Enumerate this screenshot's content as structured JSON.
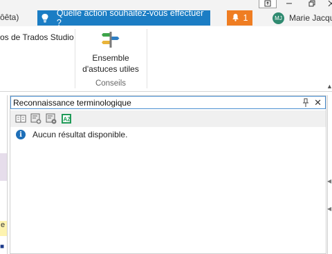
{
  "titlebar": {
    "beta_fragment": "ôêta)",
    "tell_me": "Quelle action souhaitez-vous effectuer ?",
    "notification_count": "1",
    "user_initials": "MJ",
    "user_name": "Marie Jacqu"
  },
  "ribbon": {
    "left_text": "os de Trados Studio",
    "tips_button_label": "Ensemble d'astuces utiles",
    "group_label": "Conseils"
  },
  "left_panel": {
    "yellow_fragment": "e"
  },
  "panel": {
    "title": "Reconnaissance terminologique",
    "toolbar": [
      {
        "icon": "term-entry-icon"
      },
      {
        "icon": "add-term-icon"
      },
      {
        "icon": "term-settings-icon"
      },
      {
        "icon": "sort-az-icon"
      }
    ],
    "message": "Aucun résultat disponible."
  },
  "colors": {
    "tell_me_bg": "#1b7dc4",
    "notification_bg": "#ef7d22",
    "avatar_bg": "#2f8a70",
    "panel_focus_border": "#4a8fd0"
  }
}
